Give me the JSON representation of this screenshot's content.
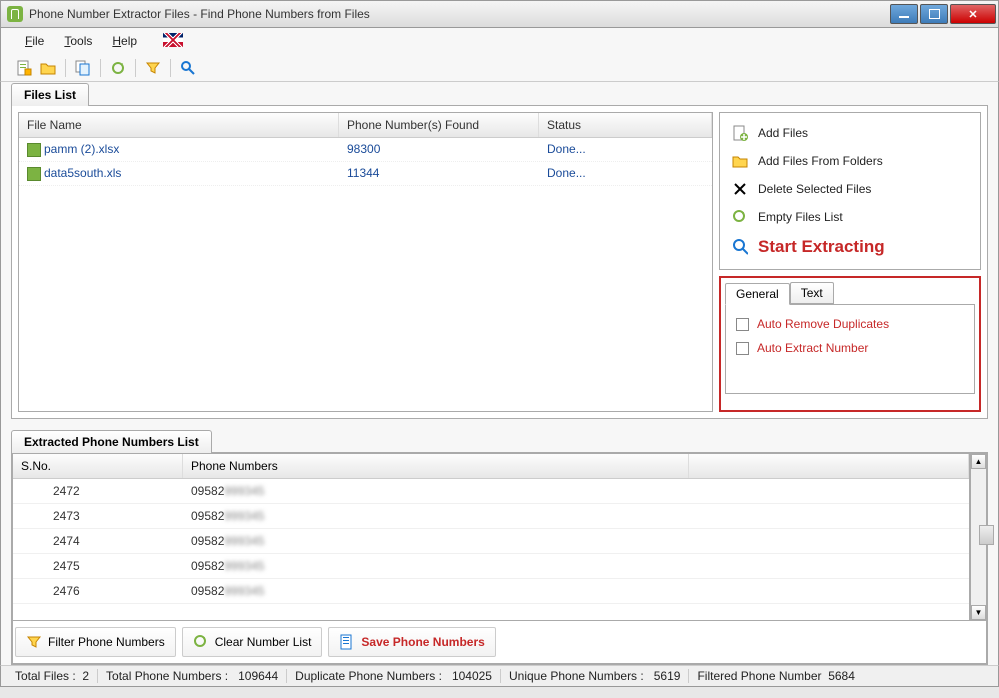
{
  "window": {
    "title": "Phone Number Extractor Files - Find Phone Numbers from Files"
  },
  "menu": {
    "file": "File",
    "tools": "Tools",
    "help": "Help"
  },
  "tabs": {
    "files_list": "Files List",
    "extracted": "Extracted Phone Numbers List"
  },
  "files_table": {
    "headers": {
      "filename": "File Name",
      "found": "Phone Number(s) Found",
      "status": "Status"
    },
    "rows": [
      {
        "name": "pamm (2).xlsx",
        "found": "98300",
        "status": "Done..."
      },
      {
        "name": "data5south.xls",
        "found": "11344",
        "status": "Done..."
      }
    ]
  },
  "side": {
    "add_files": "Add Files",
    "add_folders": "Add Files From Folders",
    "delete_selected": "Delete Selected Files",
    "empty_list": "Empty Files List",
    "start": "Start Extracting"
  },
  "options": {
    "tab_general": "General",
    "tab_text": "Text",
    "auto_remove_dup": "Auto Remove Duplicates",
    "auto_extract": "Auto Extract Number"
  },
  "ext_table": {
    "headers": {
      "sno": "S.No.",
      "pn": "Phone Numbers"
    },
    "rows": [
      {
        "sno": "2472",
        "pn_vis": "09582",
        "pn_blur": "999345"
      },
      {
        "sno": "2473",
        "pn_vis": "09582",
        "pn_blur": "999345"
      },
      {
        "sno": "2474",
        "pn_vis": "09582",
        "pn_blur": "999345"
      },
      {
        "sno": "2475",
        "pn_vis": "09582",
        "pn_blur": "999345"
      },
      {
        "sno": "2476",
        "pn_vis": "09582",
        "pn_blur": "999345"
      }
    ]
  },
  "bottom": {
    "filter": "Filter Phone Numbers",
    "clear": "Clear Number List",
    "save": "Save Phone Numbers"
  },
  "status": {
    "total_files_label": "Total Files :",
    "total_files": "2",
    "total_pn_label": "Total Phone Numbers :",
    "total_pn": "109644",
    "dup_label": "Duplicate Phone Numbers :",
    "dup": "104025",
    "uniq_label": "Unique Phone Numbers :",
    "uniq": "5619",
    "filt_label": "Filtered Phone Number",
    "filt": "5684"
  }
}
